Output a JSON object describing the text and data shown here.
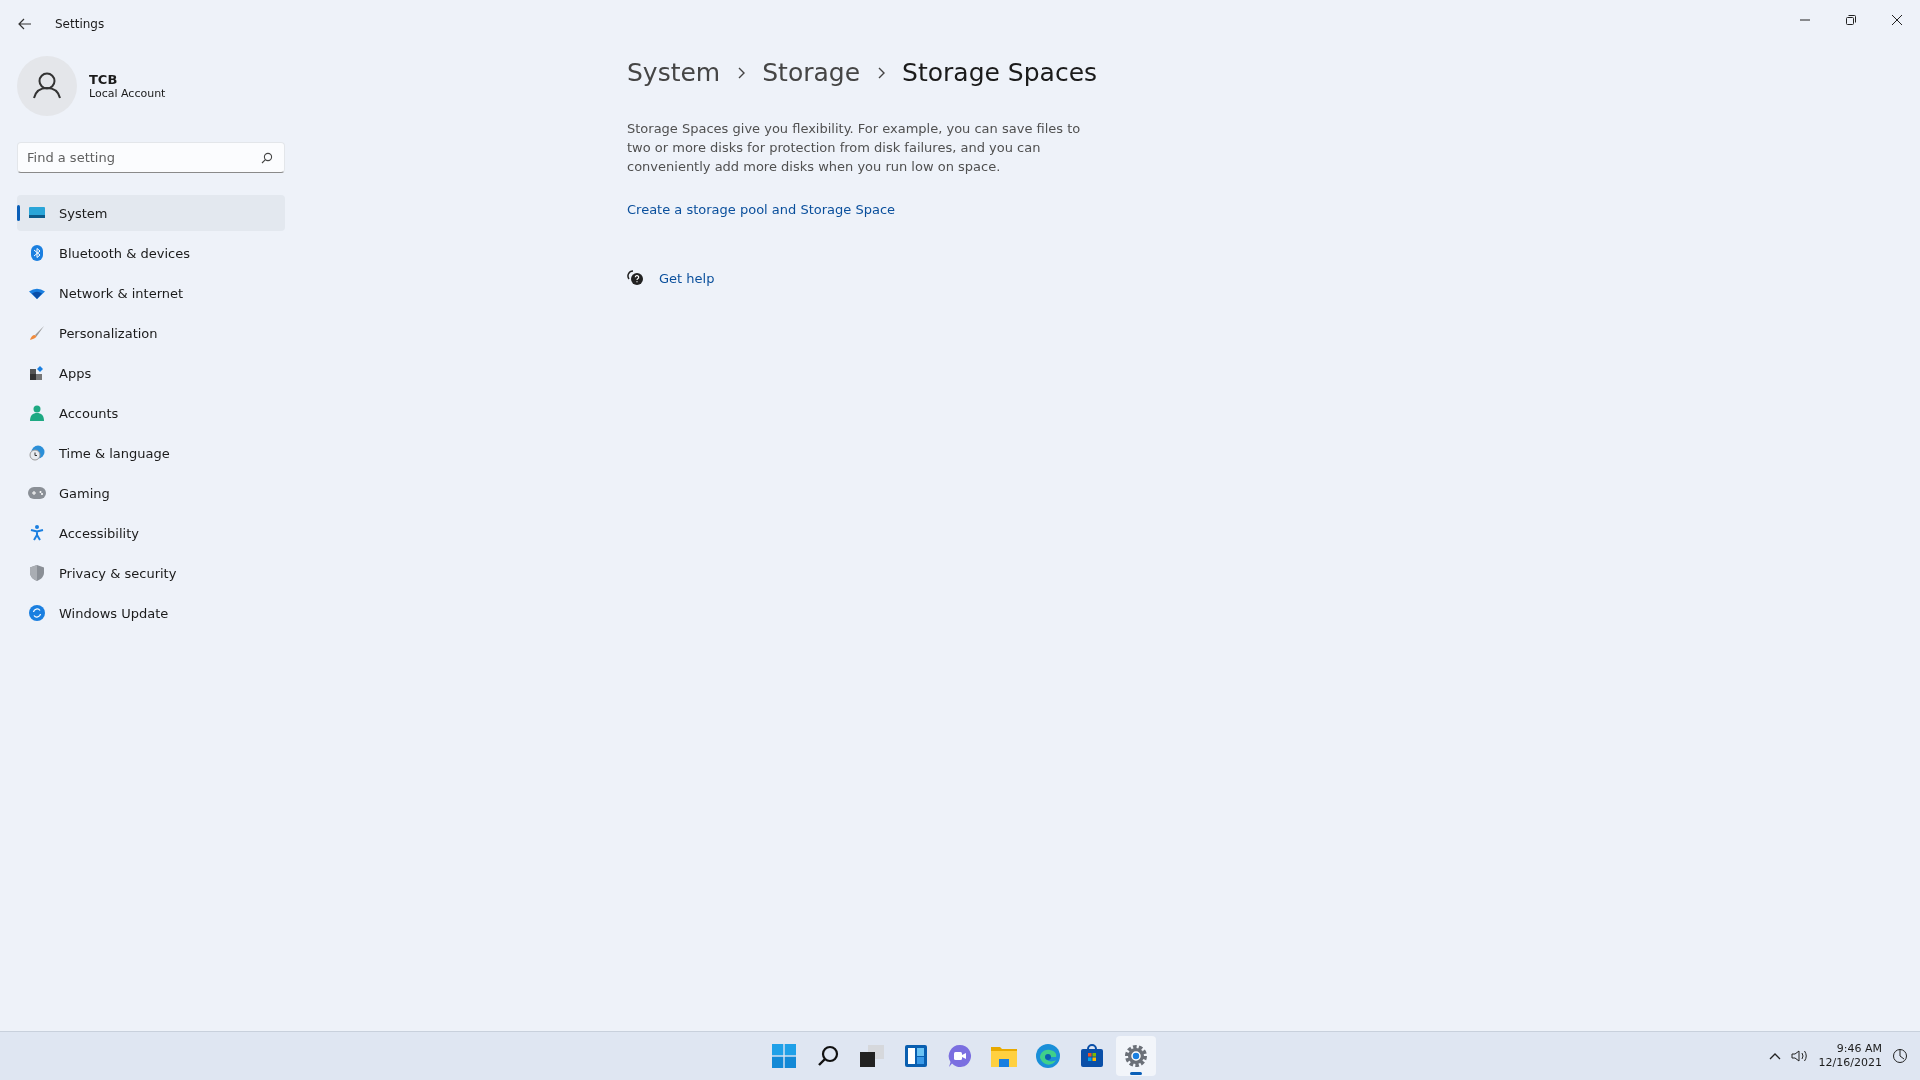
{
  "window": {
    "title": "Settings"
  },
  "account": {
    "name": "TCB",
    "type": "Local Account"
  },
  "search": {
    "placeholder": "Find a setting"
  },
  "nav": [
    {
      "label": "System",
      "kind": "system",
      "selected": true
    },
    {
      "label": "Bluetooth & devices",
      "kind": "bluetooth",
      "selected": false
    },
    {
      "label": "Network & internet",
      "kind": "wifi",
      "selected": false
    },
    {
      "label": "Personalization",
      "kind": "brush",
      "selected": false
    },
    {
      "label": "Apps",
      "kind": "apps",
      "selected": false
    },
    {
      "label": "Accounts",
      "kind": "person",
      "selected": false
    },
    {
      "label": "Time & language",
      "kind": "globe",
      "selected": false
    },
    {
      "label": "Gaming",
      "kind": "gamepad",
      "selected": false
    },
    {
      "label": "Accessibility",
      "kind": "accessibility",
      "selected": false
    },
    {
      "label": "Privacy & security",
      "kind": "shield",
      "selected": false
    },
    {
      "label": "Windows Update",
      "kind": "update",
      "selected": false
    }
  ],
  "breadcrumb": [
    "System",
    "Storage",
    "Storage Spaces"
  ],
  "description": "Storage Spaces give you flexibility. For example, you can save files to two or more disks for protection from disk failures, and you can conveniently add more disks when you run low on space.",
  "link": "Create a storage pool and Storage Space",
  "help": "Get help",
  "taskbar": {
    "apps": [
      {
        "kind": "start",
        "selected": false
      },
      {
        "kind": "search",
        "selected": false
      },
      {
        "kind": "taskview",
        "selected": false
      },
      {
        "kind": "widgets",
        "selected": false
      },
      {
        "kind": "chat",
        "selected": false
      },
      {
        "kind": "folder",
        "selected": false
      },
      {
        "kind": "browser",
        "selected": false
      },
      {
        "kind": "store",
        "selected": false
      },
      {
        "kind": "settings",
        "selected": true
      }
    ],
    "time": "9:46 AM",
    "date": "12/16/2021"
  }
}
